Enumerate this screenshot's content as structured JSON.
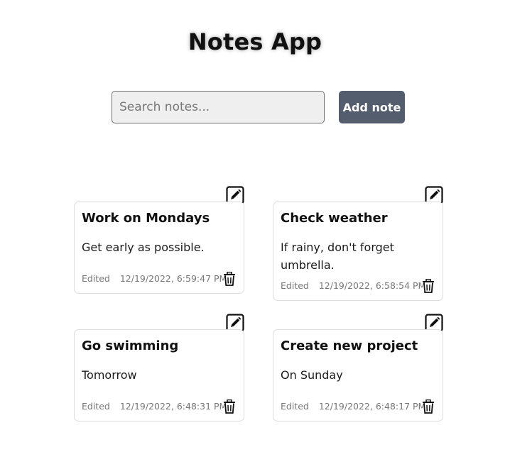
{
  "app": {
    "title": "Notes App"
  },
  "search": {
    "placeholder": "Search notes...",
    "value": ""
  },
  "add_button": {
    "label": "Add note"
  },
  "notes": [
    {
      "title": "Work on Mondays",
      "body": "Get early as possible.",
      "edited_label": "Edited",
      "timestamp": "12/19/2022, 6:59:47 PM"
    },
    {
      "title": "Check weather",
      "body": "If rainy, don't forget umbrella.",
      "edited_label": "Edited",
      "timestamp": "12/19/2022, 6:58:54 PM"
    },
    {
      "title": "Go swimming",
      "body": "Tomorrow",
      "edited_label": "Edited",
      "timestamp": "12/19/2022, 6:48:31 PM"
    },
    {
      "title": "Create new project",
      "body": "On Sunday",
      "edited_label": "Edited",
      "timestamp": "12/19/2022, 6:48:17 PM"
    }
  ],
  "icons": {
    "edit": "edit-icon",
    "delete": "trash-icon"
  }
}
